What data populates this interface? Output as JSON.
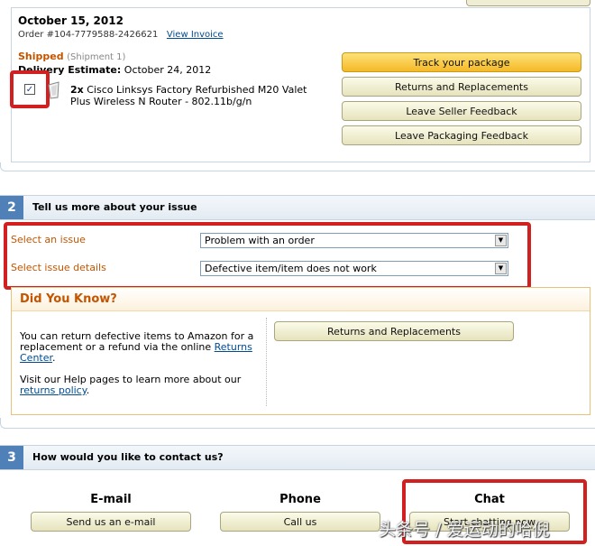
{
  "order": {
    "date": "October 15, 2012",
    "number": "Order #104-7779588-2426621",
    "view_invoice": "View Invoice",
    "status": "Shipped",
    "shipment": "(Shipment 1)",
    "delivery_label": "Delivery Estimate:",
    "delivery_date": "October 24, 2012",
    "item_qty": "2x",
    "item_name_line1": "Cisco Linksys Factory Refurbished M20 Valet",
    "item_name_line2": "Plus Wireless N Router - 802.11b/g/n",
    "checkbox_mark": "✓",
    "buttons": {
      "track": "Track your package",
      "returns": "Returns and Replacements",
      "seller_feedback": "Leave Seller Feedback",
      "packaging_feedback": "Leave Packaging Feedback"
    }
  },
  "section2": {
    "number": "2",
    "title": "Tell us more about your issue",
    "issue_label": "Select an issue",
    "issue_value": "Problem with an order",
    "details_label": "Select issue details",
    "details_value": "Defective item/item does not work"
  },
  "did_you_know": {
    "title": "Did You Know?",
    "para1_text": "You can return defective items to Amazon for a replacement or a refund via the online ",
    "para1_link": "Returns Center",
    "para1_end": ".",
    "para2_text": "Visit our Help pages to learn more about our ",
    "para2_link": "returns policy",
    "para2_end": ".",
    "button": "Returns and Replacements"
  },
  "section3": {
    "number": "3",
    "title": "How would you like to contact us?",
    "email_heading": "E-mail",
    "email_button": "Send us an e-mail",
    "phone_heading": "Phone",
    "phone_button": "Call us",
    "chat_heading": "Chat",
    "chat_button": "Start chatting now"
  },
  "watermark": "头条号 / 爱运动的哈倪",
  "colors": {
    "accent_red": "#d21f1f",
    "shipped_orange": "#c45500",
    "link_blue": "#004b91",
    "step_blue": "#4f81b8"
  }
}
